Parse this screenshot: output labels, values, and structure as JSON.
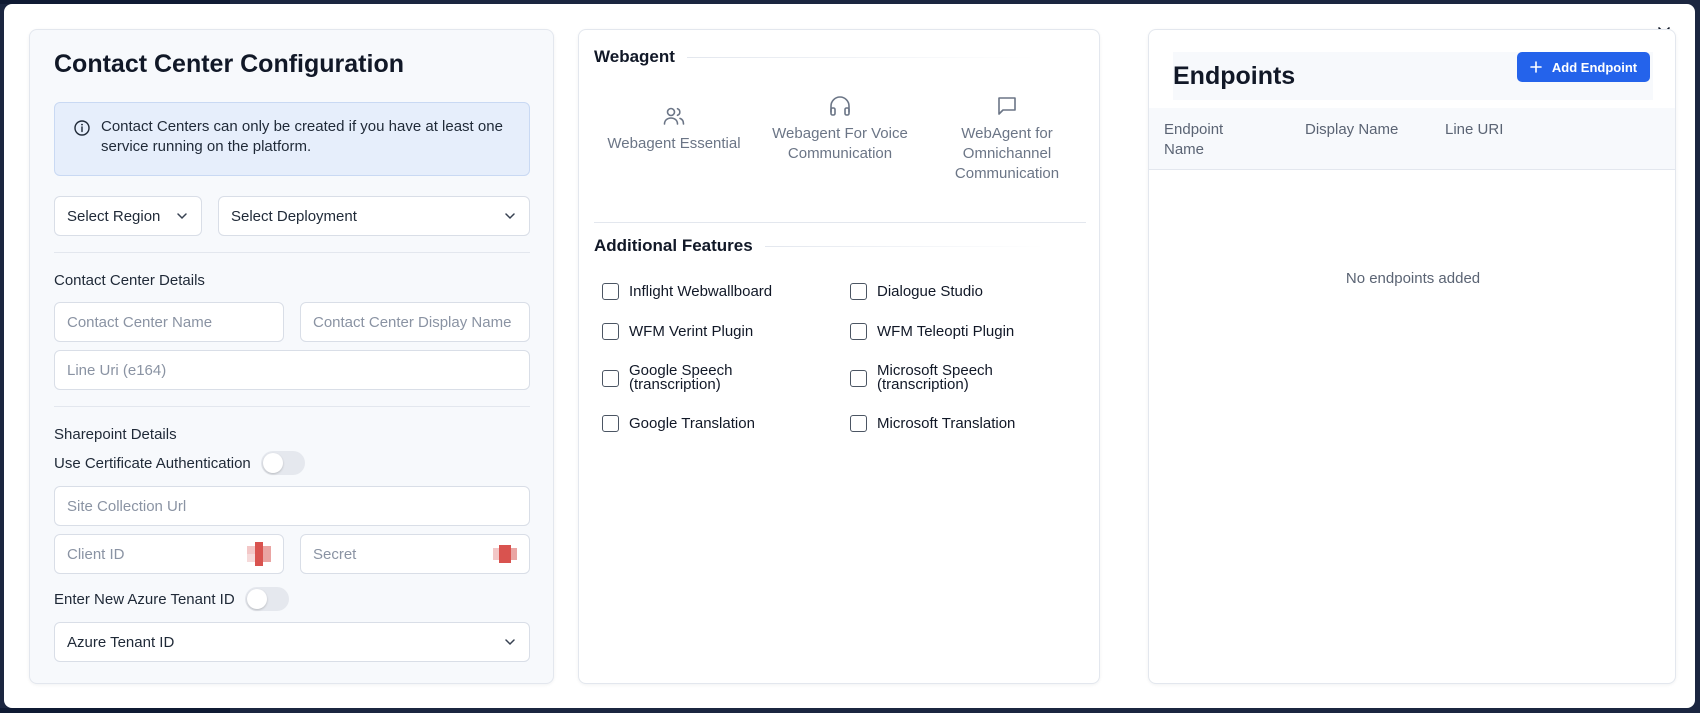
{
  "left": {
    "title": "Contact Center Configuration",
    "info": "Contact Centers can only be created if you have at least one service running on the platform.",
    "region": {
      "value": "Select Region"
    },
    "deployment": {
      "value": "Select Deployment"
    },
    "details_label": "Contact Center Details",
    "cc_name_placeholder": "Contact Center Name",
    "cc_display_placeholder": "Contact Center Display Name",
    "line_uri_placeholder": "Line Uri (e164)",
    "sharepoint_label": "Sharepoint Details",
    "cert_auth_label": "Use Certificate Authentication",
    "site_url_placeholder": "Site Collection Url",
    "client_id_placeholder": "Client ID",
    "secret_placeholder": "Secret",
    "azure_new_label": "Enter New Azure Tenant ID",
    "azure_tenant": {
      "value": "Azure Tenant ID"
    }
  },
  "mid": {
    "webagent_title": "Webagent",
    "webagents": [
      {
        "label": "Webagent Essential",
        "icon": "users-icon"
      },
      {
        "label": "Webagent For Voice Communication",
        "icon": "headphones-icon"
      },
      {
        "label": "WebAgent for Omnichannel Communication",
        "icon": "message-square-icon"
      }
    ],
    "features_title": "Additional Features",
    "features": [
      "Inflight Webwallboard",
      "Dialogue Studio",
      "WFM Verint Plugin",
      "WFM Teleopti Plugin",
      "Google Speech (transcription)",
      "Microsoft Speech (transcription)",
      "Google Translation",
      "Microsoft Translation"
    ]
  },
  "right": {
    "title": "Endpoints",
    "add_button": "Add Endpoint",
    "columns": [
      "Endpoint Name",
      "Display Name",
      "Line URI"
    ],
    "empty": "No endpoints added"
  },
  "colors": {
    "primary": "#2463eb",
    "info_bg": "#e6eefb",
    "text": "#111827",
    "muted": "#6b7586"
  }
}
